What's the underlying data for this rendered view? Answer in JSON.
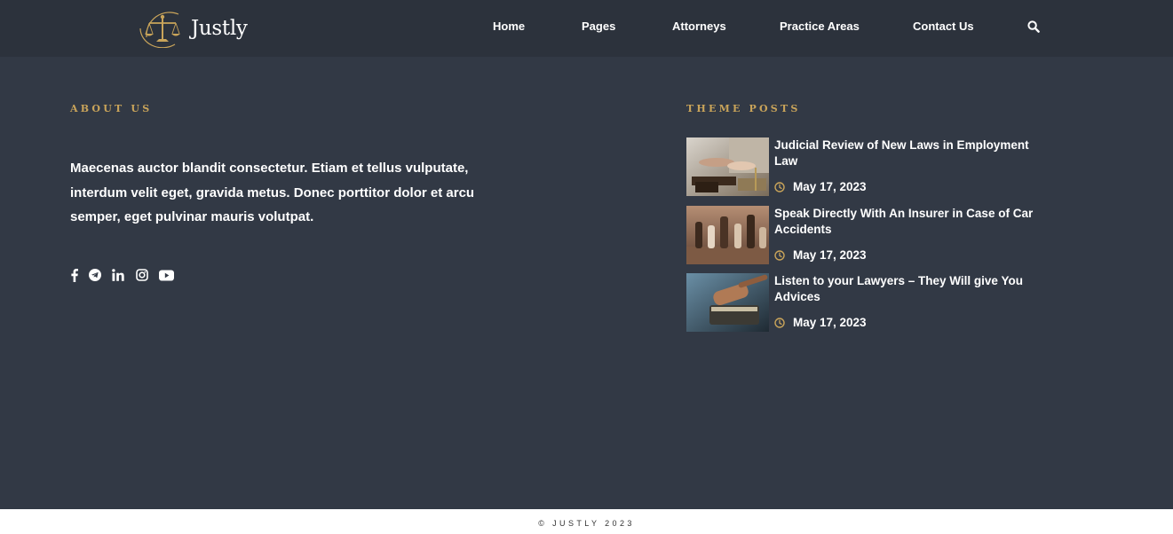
{
  "brand": {
    "name": "Justly"
  },
  "nav": {
    "items": [
      {
        "label": "Home"
      },
      {
        "label": "Pages"
      },
      {
        "label": "Attorneys"
      },
      {
        "label": "Practice Areas"
      },
      {
        "label": "Contact Us"
      }
    ],
    "search_icon": "search-icon"
  },
  "about": {
    "heading": "ABOUT US",
    "text": "Maecenas auctor blandit consectetur. Etiam et tellus vulputate, interdum velit eget, gravida metus. Donec porttitor dolor et arcu semper, eget pulvinar mauris volutpat.",
    "socials": [
      "facebook-icon",
      "telegram-icon",
      "linkedin-icon",
      "instagram-icon",
      "youtube-icon"
    ]
  },
  "posts": {
    "heading": "THEME POSTS",
    "items": [
      {
        "title": "Judicial Review of New Laws in Employment Law",
        "date": "May 17, 2023"
      },
      {
        "title": "Speak Directly With An Insurer in Case of Car Accidents",
        "date": "May 17, 2023"
      },
      {
        "title": "Listen to your Lawyers – They Will give You Advices",
        "date": "May 17, 2023"
      }
    ]
  },
  "footer": {
    "copyright": "© JUSTLY 2023"
  },
  "colors": {
    "background": "#323945",
    "header": "#2c323c",
    "accent": "#c9a45a",
    "text": "#ffffff",
    "footer": "#ffffff"
  }
}
